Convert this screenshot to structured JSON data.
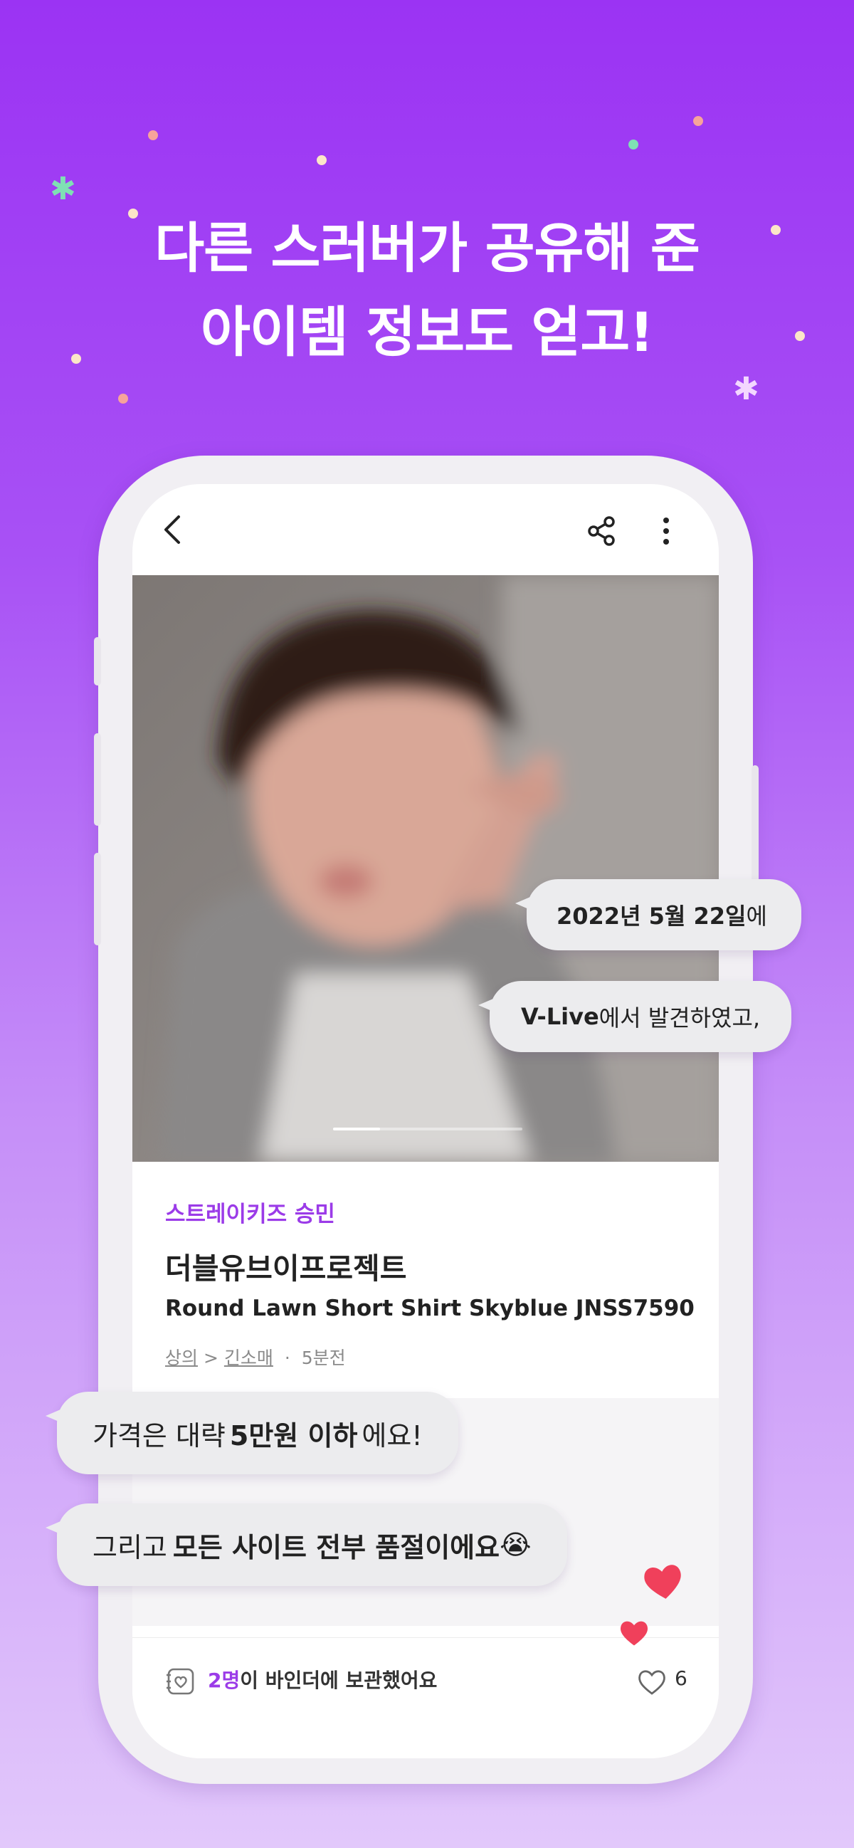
{
  "headline": {
    "line1": "다른 스러버가 공유해 준",
    "line2": "아이템 정보도 얻고!"
  },
  "topbar": {
    "back_icon": "chevron-left-icon",
    "share_icon": "share-icon",
    "more_icon": "more-vertical-icon"
  },
  "gallery": {
    "pages": 4,
    "current": 1
  },
  "item": {
    "artist": "스트레이키즈 승민",
    "brand": "더블유브이프로젝트",
    "product": "Round Lawn Short Shirt Skyblue JNSS7590",
    "category_main": "상의",
    "separator": ">",
    "category_sub": "긴소매",
    "dot": "·",
    "time": "5분전"
  },
  "bubbles": {
    "date_bold": "2022년 5월 22일",
    "date_rest": "에",
    "source_bold": "V-Live",
    "source_rest": "에서 발견하였고,",
    "price_pre": "가격은 대략 ",
    "price_bold": "5만원 이하",
    "price_post": " 에요!",
    "sold_pre": "그리고 ",
    "sold_bold": "모든 사이트 전부 품절이에요",
    "sold_emoji": "😭"
  },
  "bottombar": {
    "binder_count": "2명",
    "binder_text": "이 바인더에 보관했어요",
    "like_count": "6",
    "binder_icon": "binder-heart-icon",
    "like_icon": "heart-outline-icon"
  },
  "colors": {
    "accent": "#9b3be8",
    "heart": "#f0405b",
    "background_top": "#9b33f3",
    "background_bottom": "#e2c8fb"
  }
}
